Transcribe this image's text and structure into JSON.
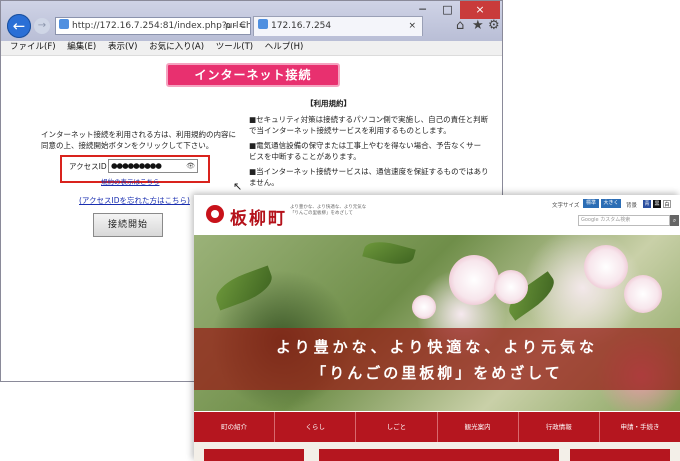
{
  "browser": {
    "address": "http://172.16.7.254:81/index.php?url=ht",
    "address_tools": "ρ - C",
    "tab_title": "172.16.7.254",
    "tab_close": "×",
    "back": "←",
    "forward": "→",
    "window_controls": {
      "minimize": "─",
      "maximize": "□",
      "close": "×"
    },
    "toolbar_icons": {
      "home": "⌂",
      "favorites": "★",
      "settings": "⚙"
    },
    "menu": [
      "ファイル(F)",
      "編集(E)",
      "表示(V)",
      "お気に入り(A)",
      "ツール(T)",
      "ヘルプ(H)"
    ]
  },
  "login_page": {
    "header_button": "インターネット接続",
    "intro_line1": "インターネット接続を利用される方は、利用規約の内容に",
    "intro_line2": "同意の上、接続開始ボタンをクリックして下さい。",
    "access_label": "アクセスID",
    "access_value": "●●●●●●●●●",
    "reveal_icon": "👁",
    "terms_link": "規約の表示はこちら",
    "forgot_link": "(アクセスIDを忘れた方はこちら)",
    "start_button": "接続開始",
    "terms_title": "【利用規約】",
    "terms": [
      "■セキュリティ対策は接続するパソコン側で実施し、自己の責任と判断",
      "で当インターネット接続サービスを利用するものとします。",
      "■電気通信設備の保守または工事上やむを得ない場合、予告なくサー",
      "ビスを中断することがあります。",
      "■当インターネット接続サービスは、通信速度を保証するものではあり",
      "ません。"
    ]
  },
  "website": {
    "logo_text": "板柳町",
    "tagline": "より豊かな、より快適な、より元気な「りんごの里板柳」をめざして",
    "font_size_label": "文字サイズ",
    "font_sizes": [
      "標準",
      "大きく"
    ],
    "bg_label": "背景",
    "bg_options": [
      "青",
      "黒",
      "白"
    ],
    "search_placeholder": "Google カスタム検索",
    "search_icon": "🔍",
    "hero_line1": "より豊かな、より快適な、より元気な",
    "hero_line2": "「りんごの里板柳」をめざして",
    "nav": [
      "町の紹介",
      "くらし",
      "しごと",
      "観光案内",
      "行政情報",
      "申請・手続き"
    ],
    "colors": {
      "brand": "#b5161f",
      "pink_button": "#e8306f",
      "highlight": "#d9231d"
    }
  }
}
